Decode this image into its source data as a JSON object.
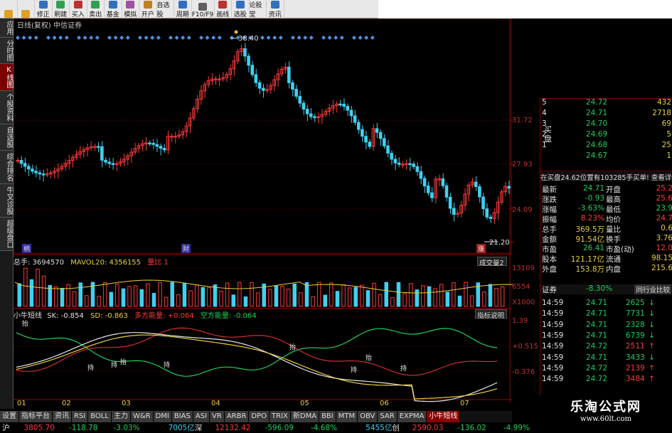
{
  "toolbar": {
    "buttons": [
      {
        "label": "",
        "icon": "back-icon"
      },
      {
        "label": "",
        "icon": "arrow-down-icon"
      },
      {
        "label": "修正",
        "icon": "edit-icon"
      },
      {
        "label": "刷建",
        "icon": "refresh-icon"
      },
      {
        "label": "买入",
        "icon": "buy-icon"
      },
      {
        "label": "卖出",
        "icon": "sell-icon"
      },
      {
        "label": "基金",
        "icon": "fund-icon"
      },
      {
        "label": "模拟",
        "icon": "simulate-icon"
      },
      {
        "label": "开户",
        "icon": "account-icon"
      },
      {
        "label": "自选股",
        "icon": "watchlist-icon"
      },
      {
        "label": "周期",
        "icon": "period-icon"
      },
      {
        "label": "F10/F9",
        "icon": "f10-icon"
      },
      {
        "label": "画线",
        "icon": "draw-icon"
      },
      {
        "label": "选股",
        "icon": "select-icon"
      },
      {
        "label": "论股堂",
        "icon": "forum-icon"
      },
      {
        "label": "资讯",
        "icon": "news-icon"
      }
    ]
  },
  "left_tabs": [
    "应用",
    "分时图",
    "K线图",
    "个股资料",
    "自选股",
    "综合排名",
    "牛叉诊股",
    "超级盘口"
  ],
  "active_left_tab": 2,
  "main_chart": {
    "title": "日线(复权)  中信证券",
    "high_label": "38.40",
    "low_label": "21.20",
    "price_ticks": [
      "31.72",
      "27.93",
      "24.09"
    ],
    "event_labels": [
      "柄",
      "财",
      "涨"
    ]
  },
  "volume_panel": {
    "header_total": "总手: 3694570",
    "header_ma": "MAVOL20: 4356155",
    "header_ratio": "量比  1",
    "dropdown": "成交量2",
    "ticks": [
      "13109",
      "6554",
      "X1000"
    ]
  },
  "indicator_panel": {
    "header_name": "小牛短线",
    "sk": "SK: -0.854",
    "sd": "SD: -0.863",
    "bull": "多方能量: +0.064",
    "bear": "空方能量: -0.064",
    "explain_button": "指标说明",
    "ticks": [
      "1.39",
      "+0.515",
      "-0.376"
    ],
    "signals": [
      "抬",
      "持",
      "持",
      "抬",
      "持",
      "抬",
      "持",
      "抬",
      "持"
    ]
  },
  "month_labels": [
    "01",
    "02",
    "03",
    "04",
    "05",
    "06",
    "07"
  ],
  "order_book": {
    "sell": [
      {
        "level": "5",
        "price": "24.72",
        "vol": "432"
      },
      {
        "level": "4",
        "price": "24.71",
        "vol": "2718"
      },
      {
        "level": "3",
        "price": "24.70",
        "vol": "69"
      },
      {
        "level": "2",
        "price": "24.69",
        "vol": "5"
      },
      {
        "level": "1",
        "price": "24.68",
        "vol": "25"
      },
      {
        "level": "",
        "price": "24.67",
        "vol": "1"
      }
    ],
    "side_label": "买盘",
    "notice": "在买盘24.62位置有103285手买单! 查看详情"
  },
  "quote_rows": [
    {
      "k1": "最新",
      "v1": "24.71",
      "k2": "开盘",
      "v2": "25.2"
    },
    {
      "k1": "涨跌",
      "v1": "-0.93",
      "k2": "最高",
      "v2": "25.6"
    },
    {
      "k1": "涨幅",
      "v1": "-3.63%",
      "k2": "最低",
      "v2": "23.9"
    },
    {
      "k1": "振幅",
      "v1": "8.23%",
      "k2": "均价",
      "v2": "24.7"
    },
    {
      "k1": "总手",
      "v1": "369.5万",
      "k2": "量比",
      "v2": "0.6"
    },
    {
      "k1": "金额",
      "v1": "91.54亿",
      "k2": "换手",
      "v2": "3.76"
    },
    {
      "k1": "市盈",
      "v1": "26.41",
      "k2": "市盈(动)",
      "v2": "12.0"
    },
    {
      "k1": "股本",
      "v1": "121.17亿",
      "k2": "流通",
      "v2": "98.15"
    },
    {
      "k1": "外盘",
      "v1": "153.8万",
      "k2": "内盘",
      "v2": "215.6"
    }
  ],
  "sector_row": {
    "name": "证券",
    "change": "-8.30%",
    "button": "同行业比较"
  },
  "ticks_list": [
    {
      "time": "14:59",
      "price": "24.71",
      "vol": "2625",
      "dir": "down"
    },
    {
      "time": "14:59",
      "price": "24.71",
      "vol": "7731",
      "dir": "down"
    },
    {
      "time": "14:59",
      "price": "24.71",
      "vol": "2328",
      "dir": "down"
    },
    {
      "time": "14:59",
      "price": "24.71",
      "vol": "6739",
      "dir": "down"
    },
    {
      "time": "14:59",
      "price": "24.72",
      "vol": "2511",
      "dir": "up"
    },
    {
      "time": "14:59",
      "price": "24.71",
      "vol": "3433",
      "dir": "down"
    },
    {
      "time": "14:59",
      "price": "24.72",
      "vol": "2139",
      "dir": "up"
    },
    {
      "time": "14:59",
      "price": "24.72",
      "vol": "3484",
      "dir": "up"
    }
  ],
  "bottom_tabs": [
    "设置",
    "指标平台",
    "资讯",
    "RSI",
    "BOLL",
    "主力",
    "W&R",
    "DMI",
    "BIAS",
    "ASI",
    "VR",
    "ARBR",
    "DPO",
    "TRIX",
    "新DMA",
    "BBI",
    "MTM",
    "OBV",
    "SAR",
    "EXPMA",
    "小牛短线"
  ],
  "active_bottom_tab": 20,
  "status_bar": {
    "index1": "沪",
    "v1": "3805.70",
    "c1": "-118.78",
    "p1": "-3.03%",
    "a1": "7005亿",
    "index2": "深",
    "v2": "12132.42",
    "c2": "-596.09",
    "p2": "-4.68%",
    "a2": "5455亿",
    "index3": "创",
    "v3": "2590.03",
    "c3": "-136.02",
    "p3": "-4.99%"
  },
  "watermark": {
    "title": "乐淘公式网",
    "url": "www.60lt.com"
  },
  "colors": {
    "up": "#ff3a3a",
    "down": "#21d05a",
    "candle_down": "#40d0f0",
    "axis": "#7a0000"
  }
}
